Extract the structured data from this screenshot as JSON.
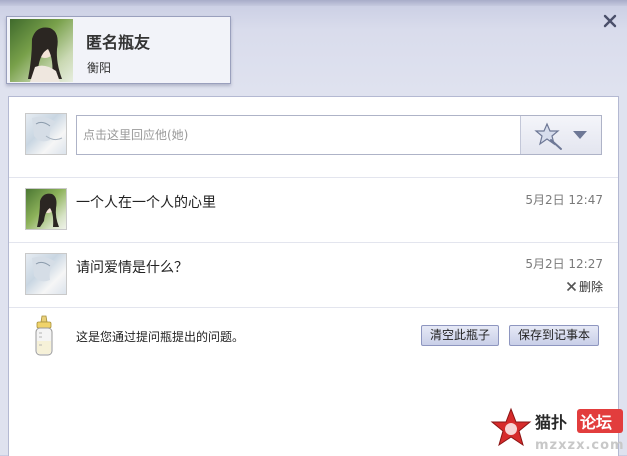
{
  "profile": {
    "name": "匿名瓶友",
    "location": "衡阳"
  },
  "reply": {
    "placeholder": "点击这里回应他(她)"
  },
  "messages": [
    {
      "text": "一个人在一个人的心里",
      "time": "5月2日 12:47"
    },
    {
      "text": "请问爱情是什么？",
      "time": "5月2日 12:27",
      "action": "删除"
    }
  ],
  "footer": {
    "info": "这是您通过提问瓶提出的问题。",
    "clear_button": "清空此瓶子",
    "save_button": "保存到记事本"
  },
  "watermark": {
    "text_top": "猫扑论坛",
    "text_bottom": "mzxzx.com"
  },
  "icons": {
    "close": "close-icon",
    "emoji": "magic-wand-icon",
    "delete": "x-icon",
    "bottle": "baby-bottle-icon"
  },
  "colors": {
    "panel_border": "#b4b9d2",
    "button_bg": "#c9cfe8",
    "time_text": "#7a7a7a"
  }
}
